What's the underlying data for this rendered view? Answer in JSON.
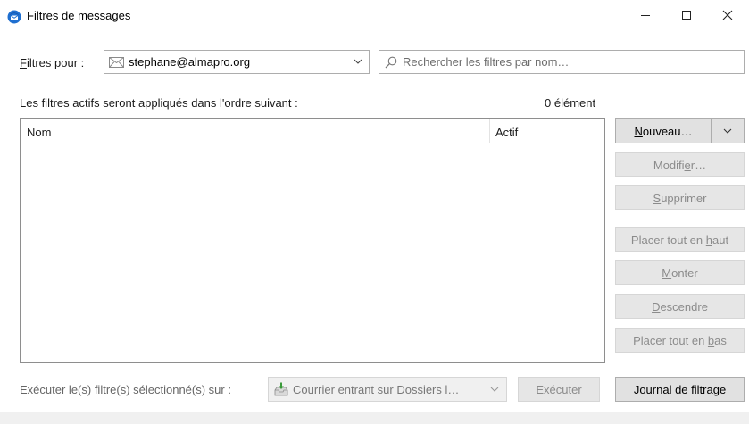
{
  "window": {
    "title": "Filtres de messages",
    "controls": [
      "minimize",
      "maximize",
      "close"
    ]
  },
  "filters_for": {
    "label_accel": "F",
    "label_rest": "iltres pour :",
    "account": "stephane@almapro.org",
    "icon": "mail-icon"
  },
  "search": {
    "placeholder": "Rechercher les filtres par nom…",
    "value": ""
  },
  "list_info": {
    "description": "Les filtres actifs seront appliqués dans l'ordre suivant :",
    "count": "0 élément"
  },
  "list": {
    "columns": [
      "Nom",
      "Actif"
    ],
    "rows": []
  },
  "buttons": {
    "new_accel": "N",
    "new_rest": "ouveau…",
    "modify_pre": "Modifi",
    "modify_accel": "e",
    "modify_post": "r…",
    "delete_accel": "S",
    "delete_rest": "upprimer",
    "top_pre": "Placer tout en ",
    "top_accel": "h",
    "top_post": "aut",
    "up_accel": "M",
    "up_rest": "onter",
    "down_accel": "D",
    "down_rest": "escendre",
    "bottom_pre": "Placer tout en ",
    "bottom_accel": "b",
    "bottom_post": "as"
  },
  "run": {
    "label_pre": "Exécuter ",
    "label_accel": "l",
    "label_post": "e(s) filtre(s) sélectionné(s) sur :",
    "folder": "Courrier entrant sur Dossiers l…",
    "run_pre": "E",
    "run_accel": "x",
    "run_post": "écuter",
    "log_accel": "J",
    "log_rest": "ournal de filtrage"
  }
}
